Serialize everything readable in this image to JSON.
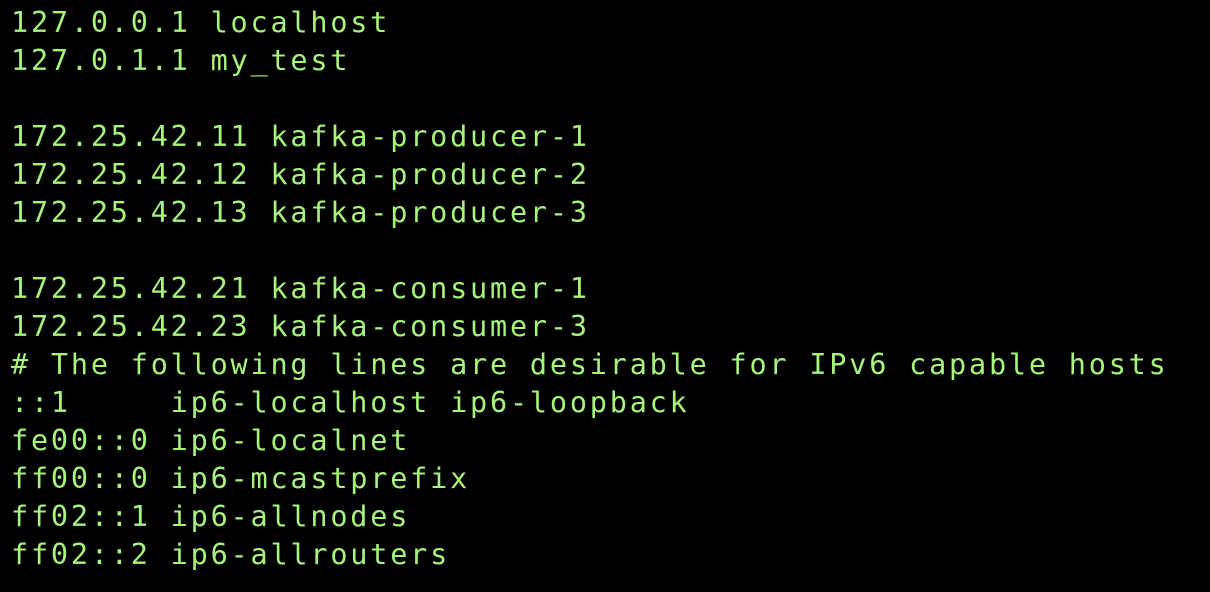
{
  "terminal": {
    "text_color": "#a6f47c",
    "background_color": "#000000",
    "lines": [
      "127.0.0.1 localhost",
      "127.0.1.1 my_test",
      "",
      "172.25.42.11 kafka-producer-1",
      "172.25.42.12 kafka-producer-2",
      "172.25.42.13 kafka-producer-3",
      "",
      "172.25.42.21 kafka-consumer-1",
      "172.25.42.23 kafka-consumer-3",
      "# The following lines are desirable for IPv6 capable hosts",
      "::1     ip6-localhost ip6-loopback",
      "fe00::0 ip6-localnet",
      "ff00::0 ip6-mcastprefix",
      "ff02::1 ip6-allnodes",
      "ff02::2 ip6-allrouters"
    ]
  }
}
